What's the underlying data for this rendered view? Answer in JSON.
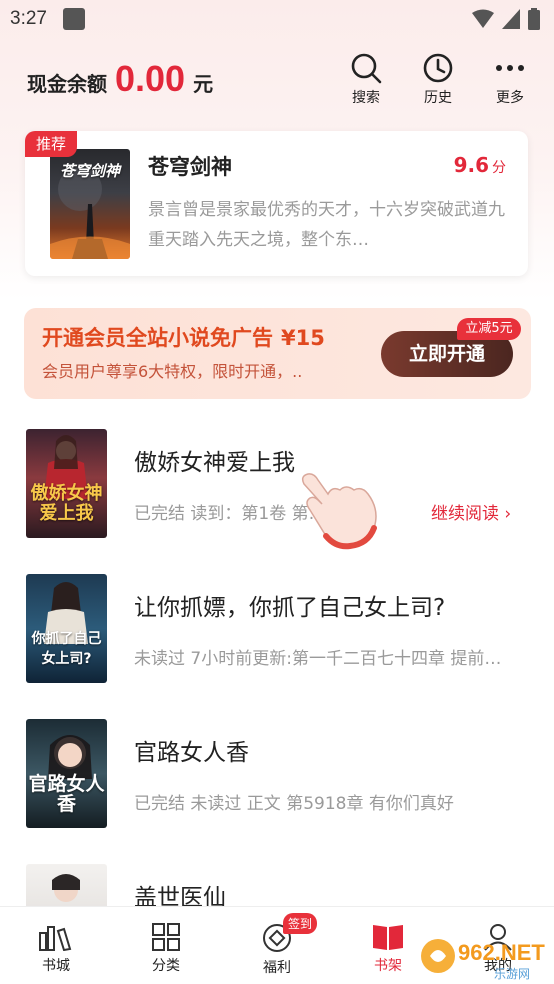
{
  "status_bar": {
    "time": "3:27"
  },
  "header": {
    "balance_label": "现金余额",
    "balance_amount": "0.00",
    "balance_unit": "元",
    "search_label": "搜索",
    "history_label": "历史",
    "more_label": "更多"
  },
  "recommend": {
    "tag": "推荐",
    "cover_text": "苍穹剑神",
    "title": "苍穹剑神",
    "score": "9.6",
    "score_unit": "分",
    "description": "景言曾是景家最优秀的天才，十六岁突破武道九重天踏入先天之境，整个东…"
  },
  "vip": {
    "title": "开通会员全站小说免广告",
    "price": "¥15",
    "subtitle": "会员用户尊享6大特权，限时开通，..",
    "button": "立即开通",
    "badge": "立减5元"
  },
  "books": [
    {
      "title": "傲娇女神爱上我",
      "meta": "已完结 读到：第1卷 第…　楚…",
      "continue": "继续阅读 ›",
      "cover_text": "傲娇女神爱上我"
    },
    {
      "title": "让你抓嫖，你抓了自己女上司?",
      "meta": "未读过 7小时前更新:第一千二百七十四章  提前…",
      "cover_text": "你抓了自己女上司?"
    },
    {
      "title": "官路女人香",
      "meta": "已完结 未读过 正文 第5918章 有你们真好",
      "cover_text": "官路女人香"
    },
    {
      "title": "盖世医仙"
    }
  ],
  "tabs": [
    {
      "label": "书城"
    },
    {
      "label": "分类"
    },
    {
      "label": "福利",
      "badge": "签到"
    },
    {
      "label": "书架"
    },
    {
      "label": "我的"
    }
  ],
  "watermark": {
    "text": "962.NET",
    "sub": "乐游网"
  },
  "colors": {
    "accent": "#e2283a",
    "vip_text": "#e0491f",
    "vip_button": "#5a2c24"
  }
}
